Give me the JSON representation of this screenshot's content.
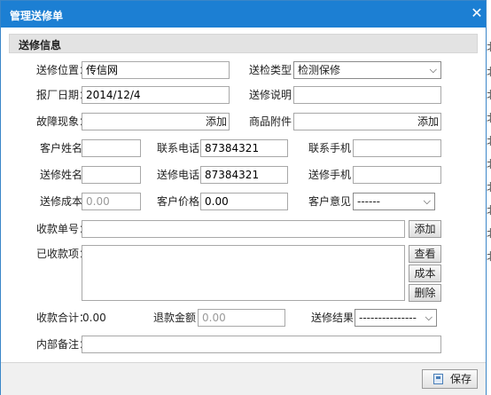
{
  "window": {
    "title": "管理送修单",
    "close_glyph": "✕"
  },
  "section": {
    "title": "送修信息"
  },
  "background": {
    "chars": [
      "北",
      "北",
      "北",
      "北",
      "北",
      "北",
      "北",
      "北",
      "北",
      "北"
    ]
  },
  "form": {
    "repair_location": {
      "label": "送修位置：",
      "value": "传信网"
    },
    "inspection_type": {
      "label": "送检类型：",
      "value": "检测保修"
    },
    "factory_date": {
      "label": "报厂日期：",
      "value": "2014/12/4"
    },
    "repair_note": {
      "label": "送修说明：",
      "value": ""
    },
    "fault": {
      "label": "故障现象：",
      "value": "",
      "add": "添加"
    },
    "accessories": {
      "label": "商品附件：",
      "value": "",
      "add": "添加"
    },
    "customer_name": {
      "label": "客户姓名：",
      "value": ""
    },
    "contact_phone": {
      "label": "联系电话：",
      "value": "87384321"
    },
    "contact_mobile": {
      "label": "联系手机：",
      "value": ""
    },
    "sender_name": {
      "label": "送修姓名：",
      "value": ""
    },
    "sender_phone": {
      "label": "送修电话：",
      "value": "87384321"
    },
    "sender_mobile": {
      "label": "送修手机：",
      "value": ""
    },
    "repair_cost": {
      "label": "送修成本：",
      "value": "0.00"
    },
    "customer_price": {
      "label": "客户价格：",
      "value": "0.00"
    },
    "customer_opinion": {
      "label": "客户意见：",
      "value": "------"
    },
    "receipt_no": {
      "label": "收款单号：",
      "value": "",
      "add_button": "添加"
    },
    "received_items": {
      "label": "已收款项："
    },
    "side_buttons": {
      "view": "查看",
      "cost": "成本",
      "delete": "删除"
    },
    "total_received": {
      "label": "收款合计：",
      "value": "0.00"
    },
    "refund_amount": {
      "label": "退款金额：",
      "value": "0.00"
    },
    "repair_result": {
      "label": "送修结果：",
      "value": "---------------"
    },
    "internal_note": {
      "label": "内部备注：",
      "value": ""
    }
  },
  "footer": {
    "save_label": "保存"
  }
}
